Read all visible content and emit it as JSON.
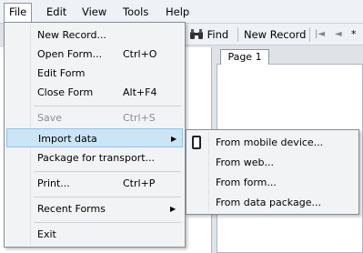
{
  "menubar": {
    "items": [
      "File",
      "Edit",
      "View",
      "Tools",
      "Help"
    ],
    "active": "File"
  },
  "toolbar": {
    "find_label": "Find",
    "new_record_label": "New Record",
    "nav_first": "|◄",
    "nav_prev": "◄",
    "extra": "*"
  },
  "form_tabs": [
    "Page 1"
  ],
  "file_menu": {
    "new_record": "New Record...",
    "open_form": "Open Form...",
    "open_form_shortcut": "Ctrl+O",
    "edit_form": "Edit Form",
    "close_form": "Close Form",
    "close_form_shortcut": "Alt+F4",
    "save": "Save",
    "save_shortcut": "Ctrl+S",
    "import_data": "Import data",
    "package_for_transport": "Package for transport...",
    "print": "Print...",
    "print_shortcut": "Ctrl+P",
    "recent_forms": "Recent Forms",
    "exit": "Exit"
  },
  "import_submenu": {
    "items": [
      "From mobile device...",
      "From web...",
      "From form...",
      "From data package..."
    ]
  },
  "colors": {
    "highlight": "#cbe4f6",
    "highlight_border": "#8ec5ec",
    "menu_bg": "#f2f3f4"
  }
}
